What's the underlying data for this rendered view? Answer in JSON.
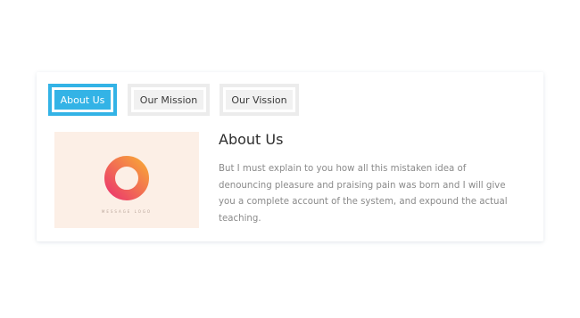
{
  "tabs": [
    {
      "label": "About Us",
      "active": true
    },
    {
      "label": "Our Mission",
      "active": false
    },
    {
      "label": "Our Vission",
      "active": false
    }
  ],
  "content": {
    "title": "About Us",
    "paragraph": "But I must explain to you how all this mistaken idea of denouncing pleasure and praising pain was born and I will give you a complete account of the system, and expound the actual teaching.",
    "image": {
      "icon": "ring-logo-icon",
      "logo_text": "MESSAGE LOGO"
    }
  },
  "colors": {
    "accent": "#33b3e6",
    "tab_inactive_bg": "#f1f1f1",
    "image_bg": "#fcefe6",
    "logo_gradient_start": "#ec3d6b",
    "logo_gradient_end": "#f7a13a"
  }
}
